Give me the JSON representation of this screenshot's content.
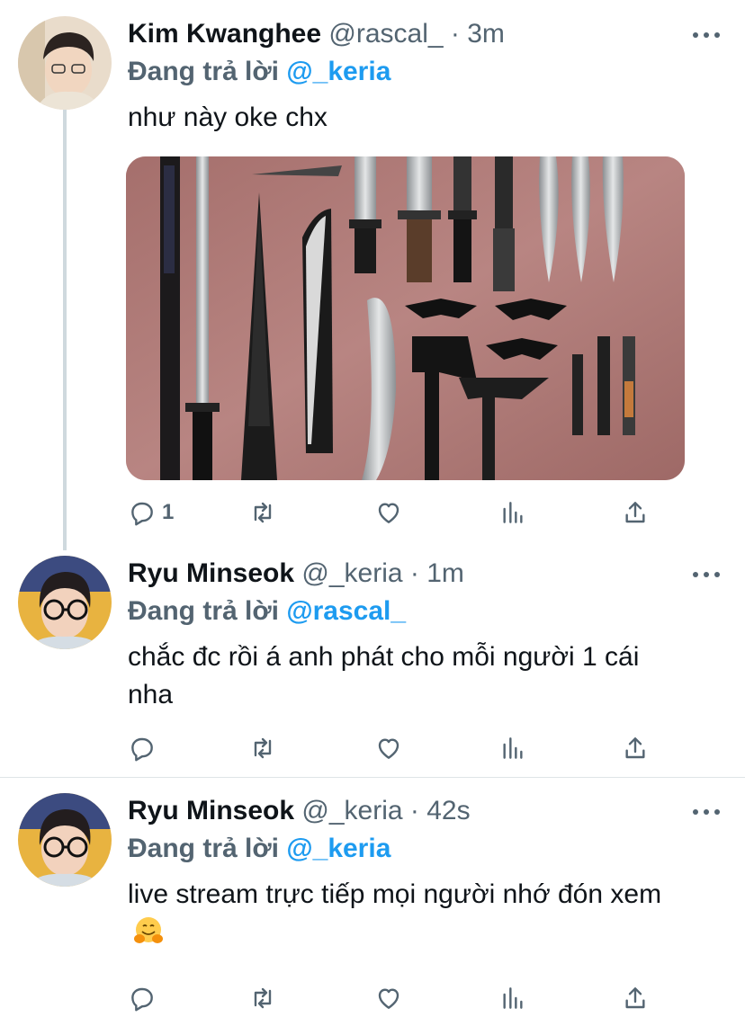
{
  "tweets": [
    {
      "name": "Kim Kwanghee",
      "handle": "@rascal_",
      "separator": "·",
      "time": "3m",
      "replying_prefix": "Đang trả lời",
      "replying_to": "@_keria",
      "text": "như này oke chx",
      "has_media": true,
      "reply_count": "1"
    },
    {
      "name": "Ryu Minseok",
      "handle": "@_keria",
      "separator": "·",
      "time": "1m",
      "replying_prefix": "Đang trả lời",
      "replying_to": "@rascal_",
      "text": "chắc đc rồi á anh phát cho mỗi người 1 cái nha",
      "reply_count": ""
    },
    {
      "name": "Ryu Minseok",
      "handle": "@_keria",
      "separator": "·",
      "time": "42s",
      "replying_prefix": "Đang trả lời",
      "replying_to": "@_keria",
      "text": "live stream trực tiếp mọi người nhớ đón xem",
      "emoji": "hugging-face-emoji",
      "reply_count": ""
    }
  ],
  "icons": [
    "reply-icon",
    "retweet-icon",
    "like-icon",
    "analytics-icon",
    "share-icon",
    "more-icon"
  ],
  "colors": {
    "accent": "#1d9bf0",
    "secondary_text": "#536471",
    "primary_text": "#0f1419",
    "media_background": "#b07a76"
  }
}
